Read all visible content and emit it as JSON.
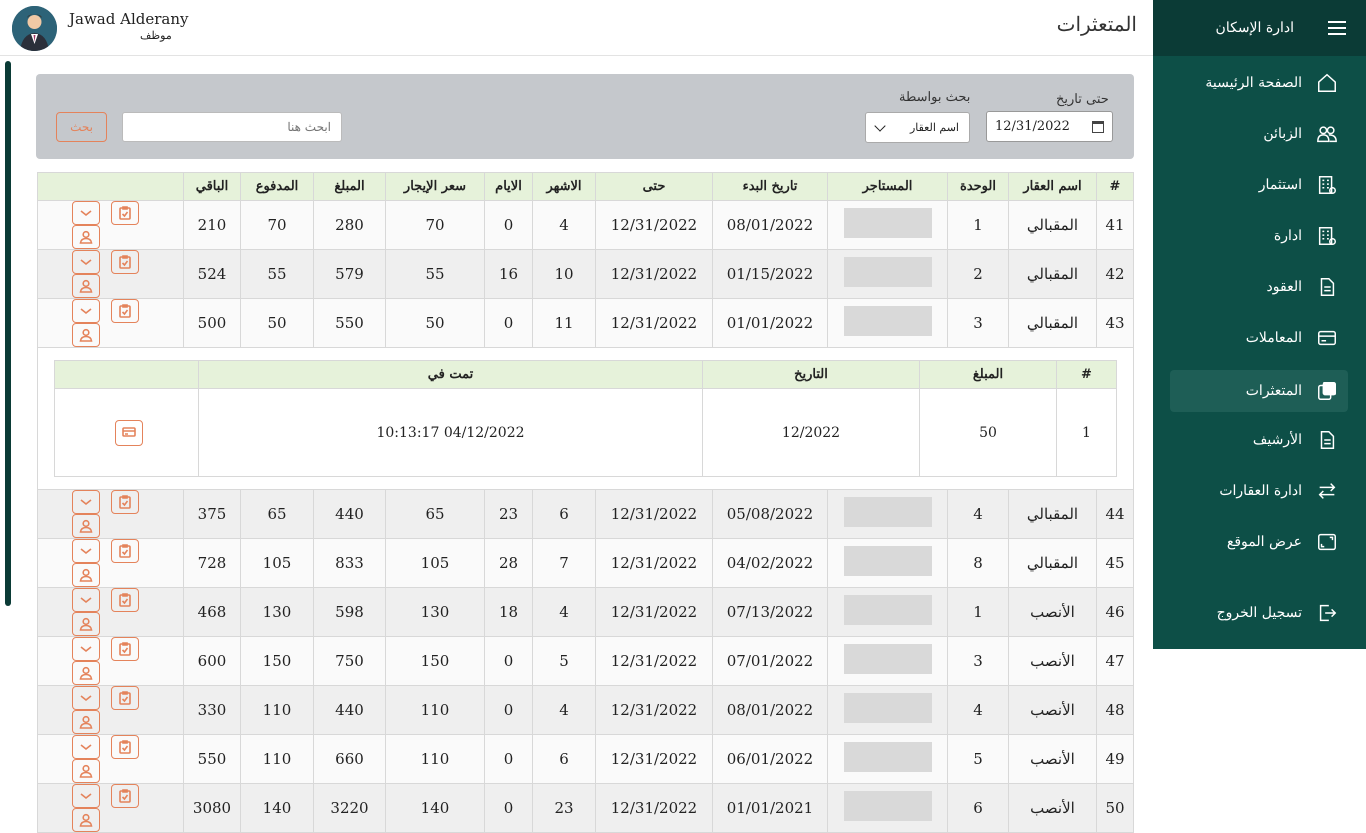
{
  "app": {
    "title": "ادارة الإسكان"
  },
  "user": {
    "name": "Jawad Alderany",
    "role": "موظف"
  },
  "page": {
    "title": "المتعثرات"
  },
  "nav": [
    {
      "label": "الصفحة الرئيسية",
      "icon": "home-icon"
    },
    {
      "label": "الزبائن",
      "icon": "users-icon"
    },
    {
      "label": "استثمار",
      "icon": "building-icon"
    },
    {
      "label": "ادارة",
      "icon": "building-icon"
    },
    {
      "label": "العقود",
      "icon": "document-icon"
    },
    {
      "label": "المعاملات",
      "icon": "card-icon"
    },
    {
      "label": "المتعثرات",
      "icon": "copy-icon",
      "active": true
    },
    {
      "label": "الأرشيف",
      "icon": "document-icon"
    },
    {
      "label": "ادارة العقارات",
      "icon": "arrows-icon"
    },
    {
      "label": "عرض الموقع",
      "icon": "screen-icon"
    },
    {
      "label": "تسجيل الخروج",
      "icon": "logout-icon"
    }
  ],
  "filter": {
    "until_label": "حتى تاريخ",
    "until_value": "12/31/2022",
    "searchby_label": "بحث بواسطة",
    "searchby_value": "اسم العقار",
    "search_placeholder": "ابحث هنا",
    "search_button": "بحث"
  },
  "table": {
    "headers": [
      "#",
      "اسم العقار",
      "الوحدة",
      "المستاجر",
      "تاريخ البدء",
      "حتى",
      "الاشهر",
      "الايام",
      "سعر الإيجار",
      "المبلغ",
      "المدفوع",
      "الباقي",
      ""
    ],
    "rows": [
      [
        "41",
        "المقبالي",
        "1",
        "",
        "08/01/2022",
        "12/31/2022",
        "4",
        "0",
        "70",
        "280",
        "70",
        "210"
      ],
      [
        "42",
        "المقبالي",
        "2",
        "",
        "01/15/2022",
        "12/31/2022",
        "10",
        "16",
        "55",
        "579",
        "55",
        "524"
      ],
      [
        "43",
        "المقبالي",
        "3",
        "",
        "01/01/2022",
        "12/31/2022",
        "11",
        "0",
        "50",
        "550",
        "50",
        "500"
      ],
      [
        "44",
        "المقبالي",
        "4",
        "",
        "05/08/2022",
        "12/31/2022",
        "6",
        "23",
        "65",
        "440",
        "65",
        "375"
      ],
      [
        "45",
        "المقبالي",
        "8",
        "",
        "04/02/2022",
        "12/31/2022",
        "7",
        "28",
        "105",
        "833",
        "105",
        "728"
      ],
      [
        "46",
        "الأنصب",
        "1",
        "",
        "07/13/2022",
        "12/31/2022",
        "4",
        "18",
        "130",
        "598",
        "130",
        "468"
      ],
      [
        "47",
        "الأنصب",
        "3",
        "",
        "07/01/2022",
        "12/31/2022",
        "5",
        "0",
        "150",
        "750",
        "150",
        "600"
      ],
      [
        "48",
        "الأنصب",
        "4",
        "",
        "08/01/2022",
        "12/31/2022",
        "4",
        "0",
        "110",
        "440",
        "110",
        "330"
      ],
      [
        "49",
        "الأنصب",
        "5",
        "",
        "06/01/2022",
        "12/31/2022",
        "6",
        "0",
        "110",
        "660",
        "110",
        "550"
      ],
      [
        "50",
        "الأنصب",
        "6",
        "",
        "01/01/2021",
        "12/31/2022",
        "23",
        "0",
        "140",
        "3220",
        "140",
        "3080"
      ]
    ]
  },
  "payments": {
    "headers": [
      "#",
      "المبلغ",
      "التاريخ",
      "تمت في",
      ""
    ],
    "rows": [
      [
        "1",
        "50",
        "12/2022",
        "04/12/2022 10:13:17"
      ]
    ]
  },
  "colors": {
    "sidebar": "#0d4f47",
    "sidebar_head": "#0b3b36",
    "accent": "#e4835b",
    "header_row": "#e6f2da"
  }
}
